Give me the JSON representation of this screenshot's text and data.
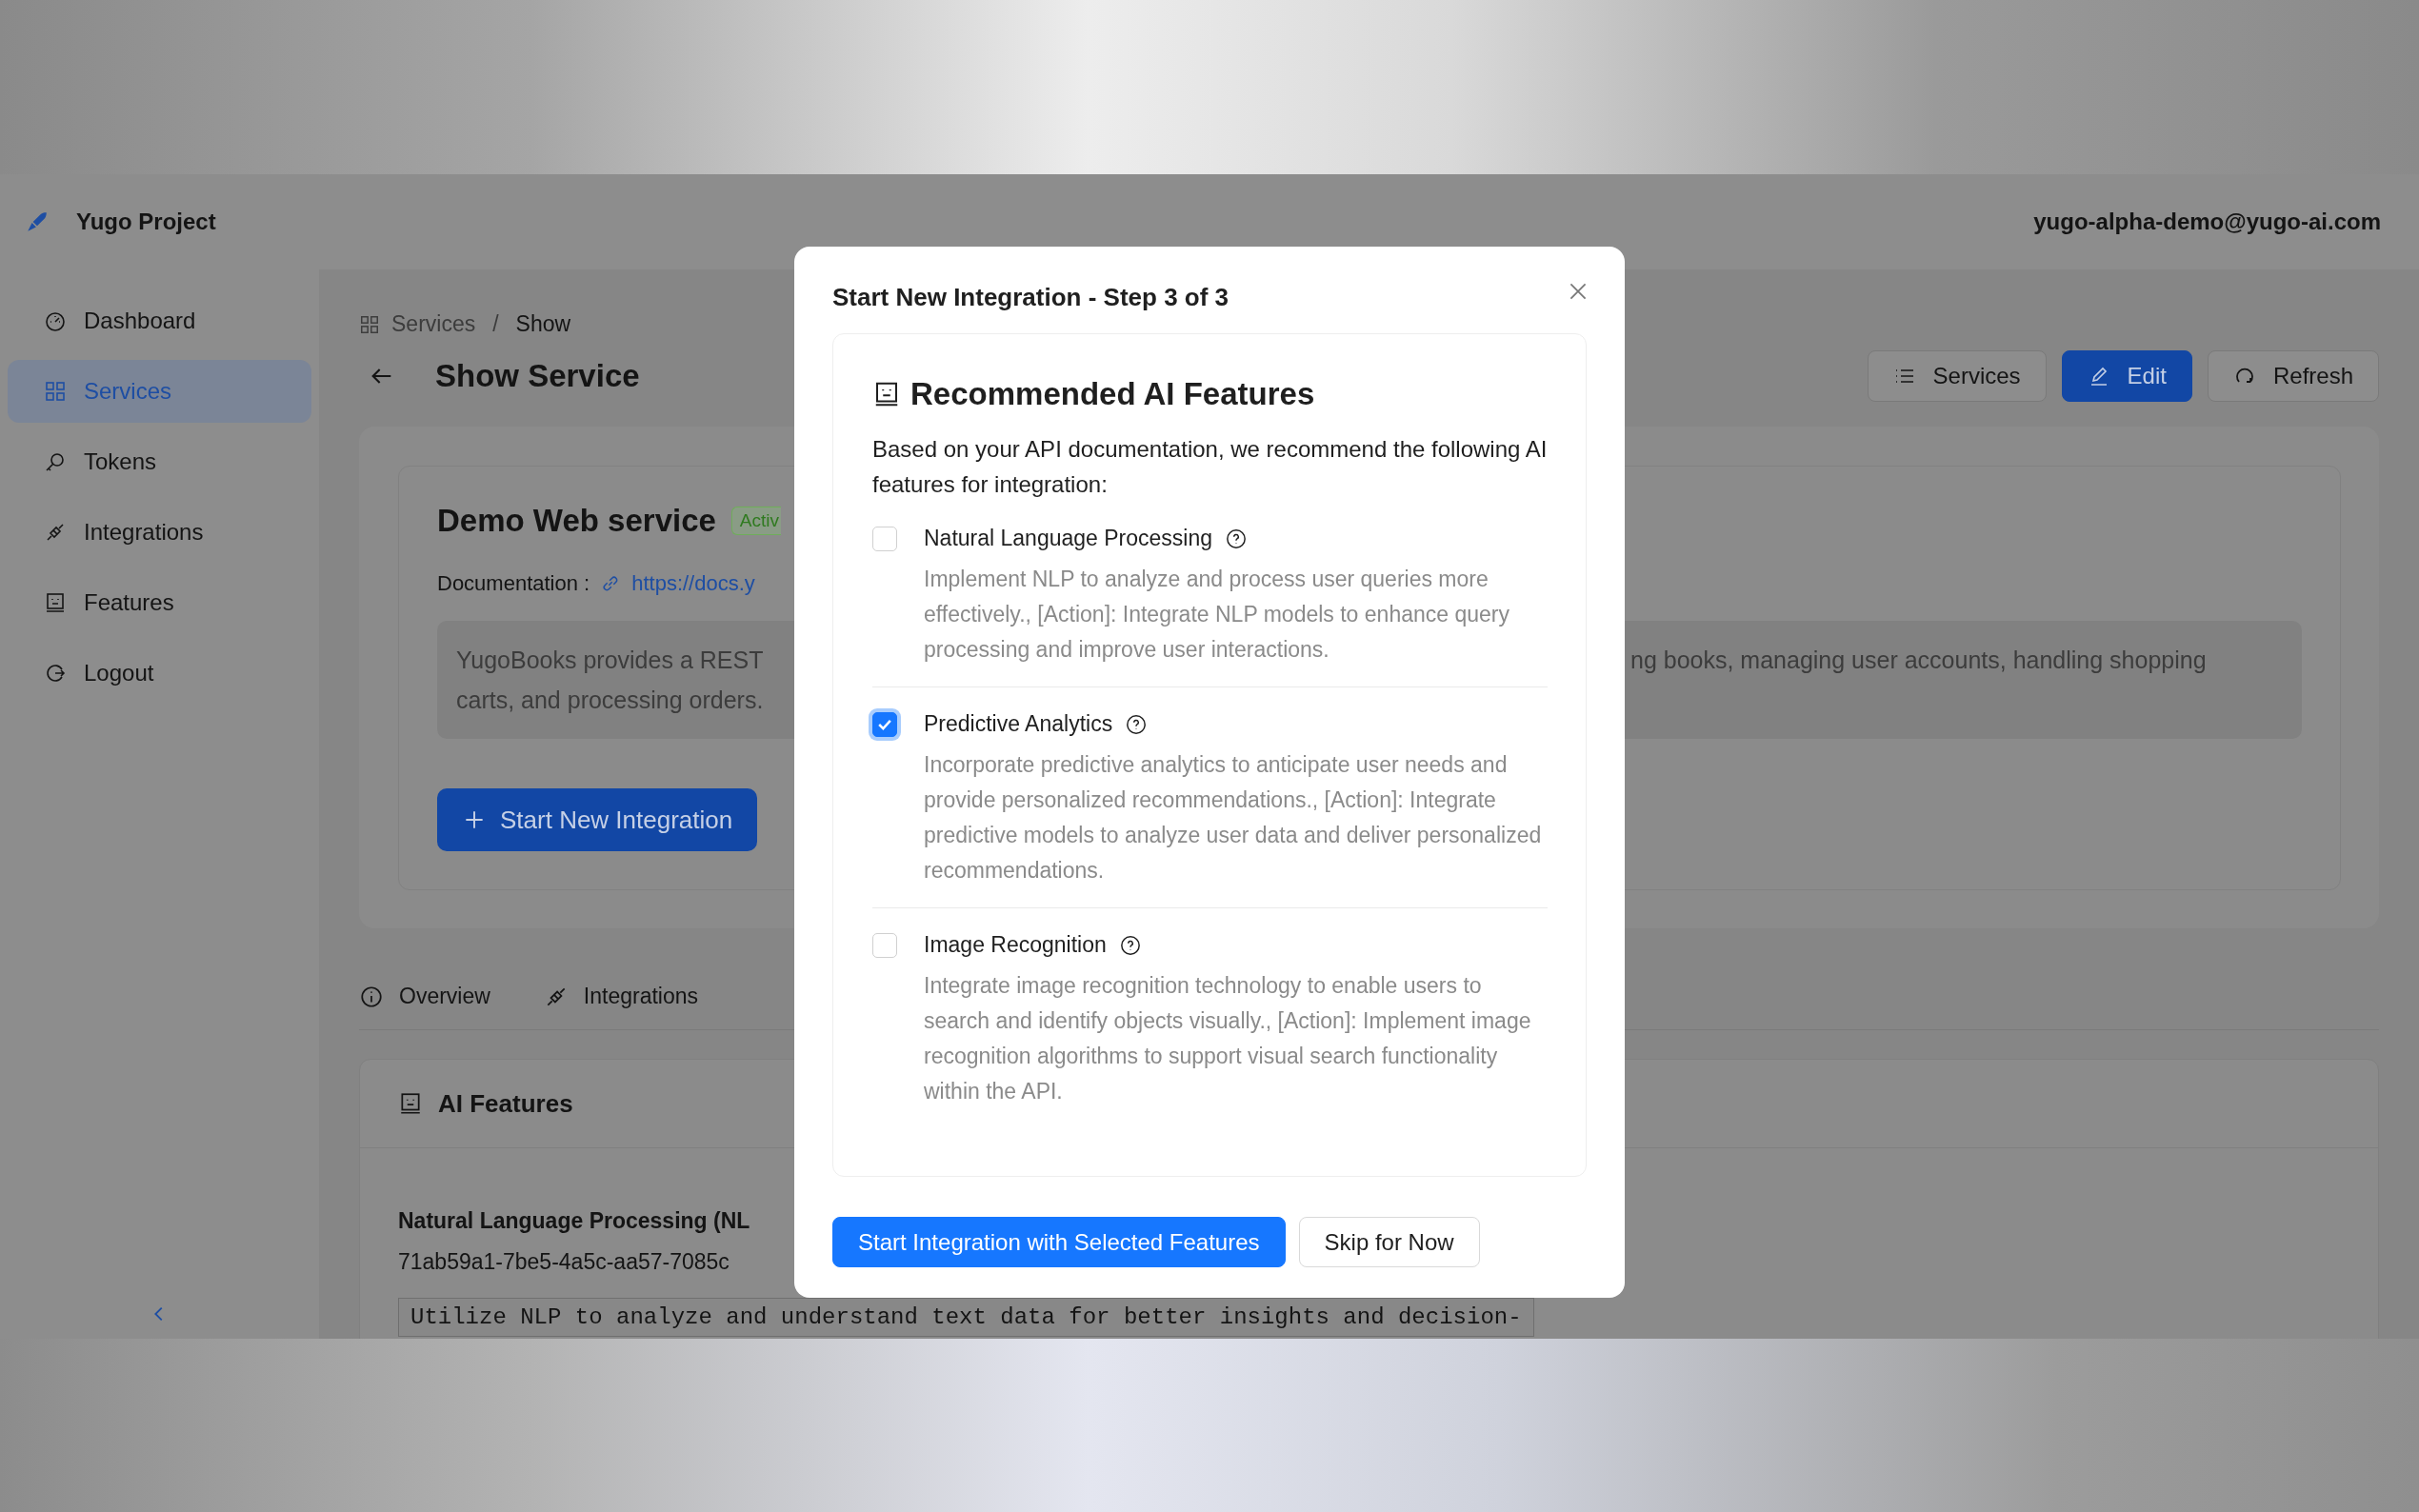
{
  "header": {
    "project": "Yugo Project",
    "user_email": "yugo-alpha-demo@yugo-ai.com"
  },
  "sidebar": {
    "items": [
      {
        "label": "Dashboard",
        "selected": false
      },
      {
        "label": "Services",
        "selected": true
      },
      {
        "label": "Tokens",
        "selected": false
      },
      {
        "label": "Integrations",
        "selected": false
      },
      {
        "label": "Features",
        "selected": false
      },
      {
        "label": "Logout",
        "selected": false
      }
    ]
  },
  "breadcrumb": [
    "Services",
    "Show"
  ],
  "breadcrumb_separator": "/",
  "page_title": "Show Service",
  "header_buttons": [
    {
      "label": "Services",
      "kind": "default"
    },
    {
      "label": "Edit",
      "kind": "primary"
    },
    {
      "label": "Refresh",
      "kind": "default"
    }
  ],
  "service": {
    "name": "Demo Web service",
    "status": "Activ",
    "documentation_label": "Documentation :",
    "documentation_link": "https://docs.y",
    "description_left": [
      "YugoBooks provides a REST",
      "carts, and processing orders."
    ],
    "description_right": "ng books, managing user accounts, handling shopping",
    "action": "Start New Integration"
  },
  "tabs": [
    {
      "label": "Overview",
      "selected": false
    },
    {
      "label": "Integrations",
      "selected": false
    }
  ],
  "ai_features": {
    "title": "AI Features",
    "feature_name": "Natural Language Processing (NL",
    "feature_id": "71ab59a1-7be5-4a5c-aa57-7085c",
    "feature_text": "Utilize NLP to analyze and understand text data for better insights and decision-"
  },
  "modal": {
    "title": "Start New Integration - Step 3 of 3",
    "heading": "Recommended AI Features",
    "intro": "Based on your API documentation, we recommend the following AI features for integration:",
    "features": [
      {
        "title": "Natural Language Processing",
        "description": "Implement NLP to analyze and process user queries more effectively., [Action]: Integrate NLP models to enhance query processing and improve user interactions.",
        "checked": false
      },
      {
        "title": "Predictive Analytics",
        "description": "Incorporate predictive analytics to anticipate user needs and provide personalized recommendations., [Action]: Integrate predictive models to analyze user data and deliver personalized recommendations.",
        "checked": true
      },
      {
        "title": "Image Recognition",
        "description": "Integrate image recognition technology to enable users to search and identify objects visually., [Action]: Implement image recognition algorithms to support visual search functionality within the API.",
        "checked": false
      }
    ],
    "buttons": [
      {
        "label": "Start Integration with Selected Features",
        "kind": "primary"
      },
      {
        "label": "Skip for Now",
        "kind": "default"
      }
    ]
  }
}
